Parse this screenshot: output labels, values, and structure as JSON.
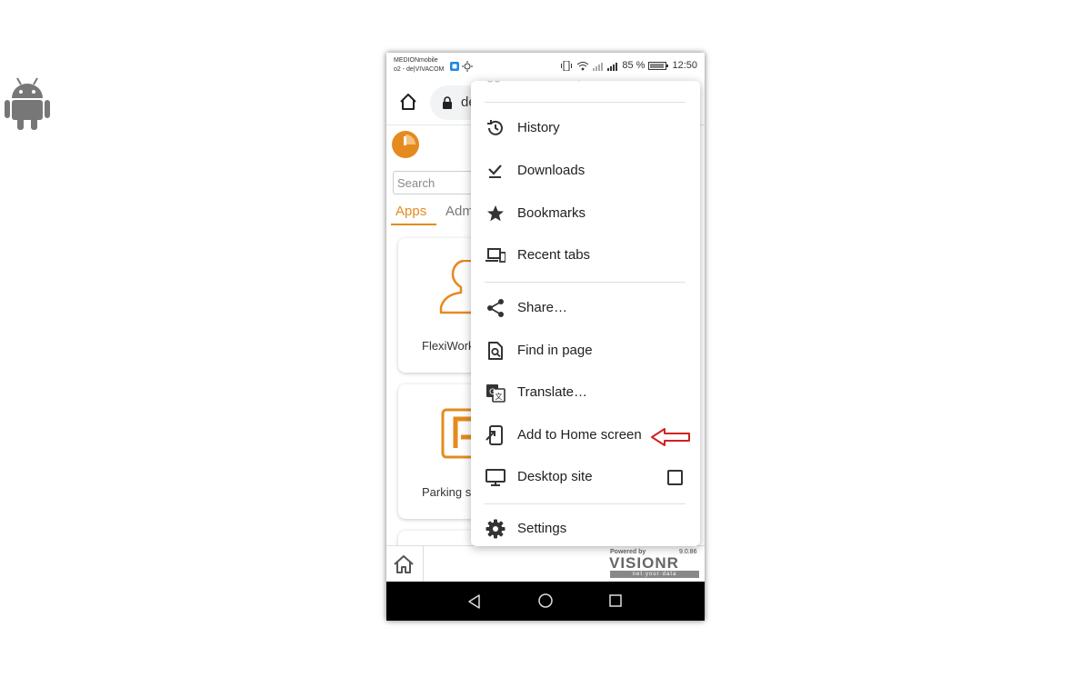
{
  "statusbar": {
    "carrier_line1": "MEDIONmobile",
    "carrier_line2": "o2 - de|VIVACOM",
    "battery": "85 %",
    "time": "12:50"
  },
  "browser": {
    "url_prefix": "de"
  },
  "page": {
    "search_placeholder": "Search",
    "tabs": [
      "Apps",
      "Adm"
    ],
    "cards": [
      {
        "label": "FlexiWork"
      },
      {
        "label": "Parking s"
      }
    ]
  },
  "footer": {
    "powered_by": "Powered by",
    "version": "9.0.86",
    "brand": "VISIONR",
    "tagline": "net·your·data"
  },
  "menu": {
    "items": [
      {
        "label": "History",
        "icon": "history-icon"
      },
      {
        "label": "Downloads",
        "icon": "download-icon"
      },
      {
        "label": "Bookmarks",
        "icon": "star-icon"
      },
      {
        "label": "Recent tabs",
        "icon": "devices-icon"
      },
      {
        "label": "Share…",
        "icon": "share-icon"
      },
      {
        "label": "Find in page",
        "icon": "find-in-page-icon"
      },
      {
        "label": "Translate…",
        "icon": "translate-icon"
      },
      {
        "label": "Add to Home screen",
        "icon": "add-to-home-icon"
      },
      {
        "label": "Desktop site",
        "icon": "desktop-icon",
        "checked": false
      },
      {
        "label": "Settings",
        "icon": "gear-icon"
      }
    ]
  },
  "colors": {
    "accent": "#e58a1f",
    "annotation_arrow": "#d22222"
  }
}
